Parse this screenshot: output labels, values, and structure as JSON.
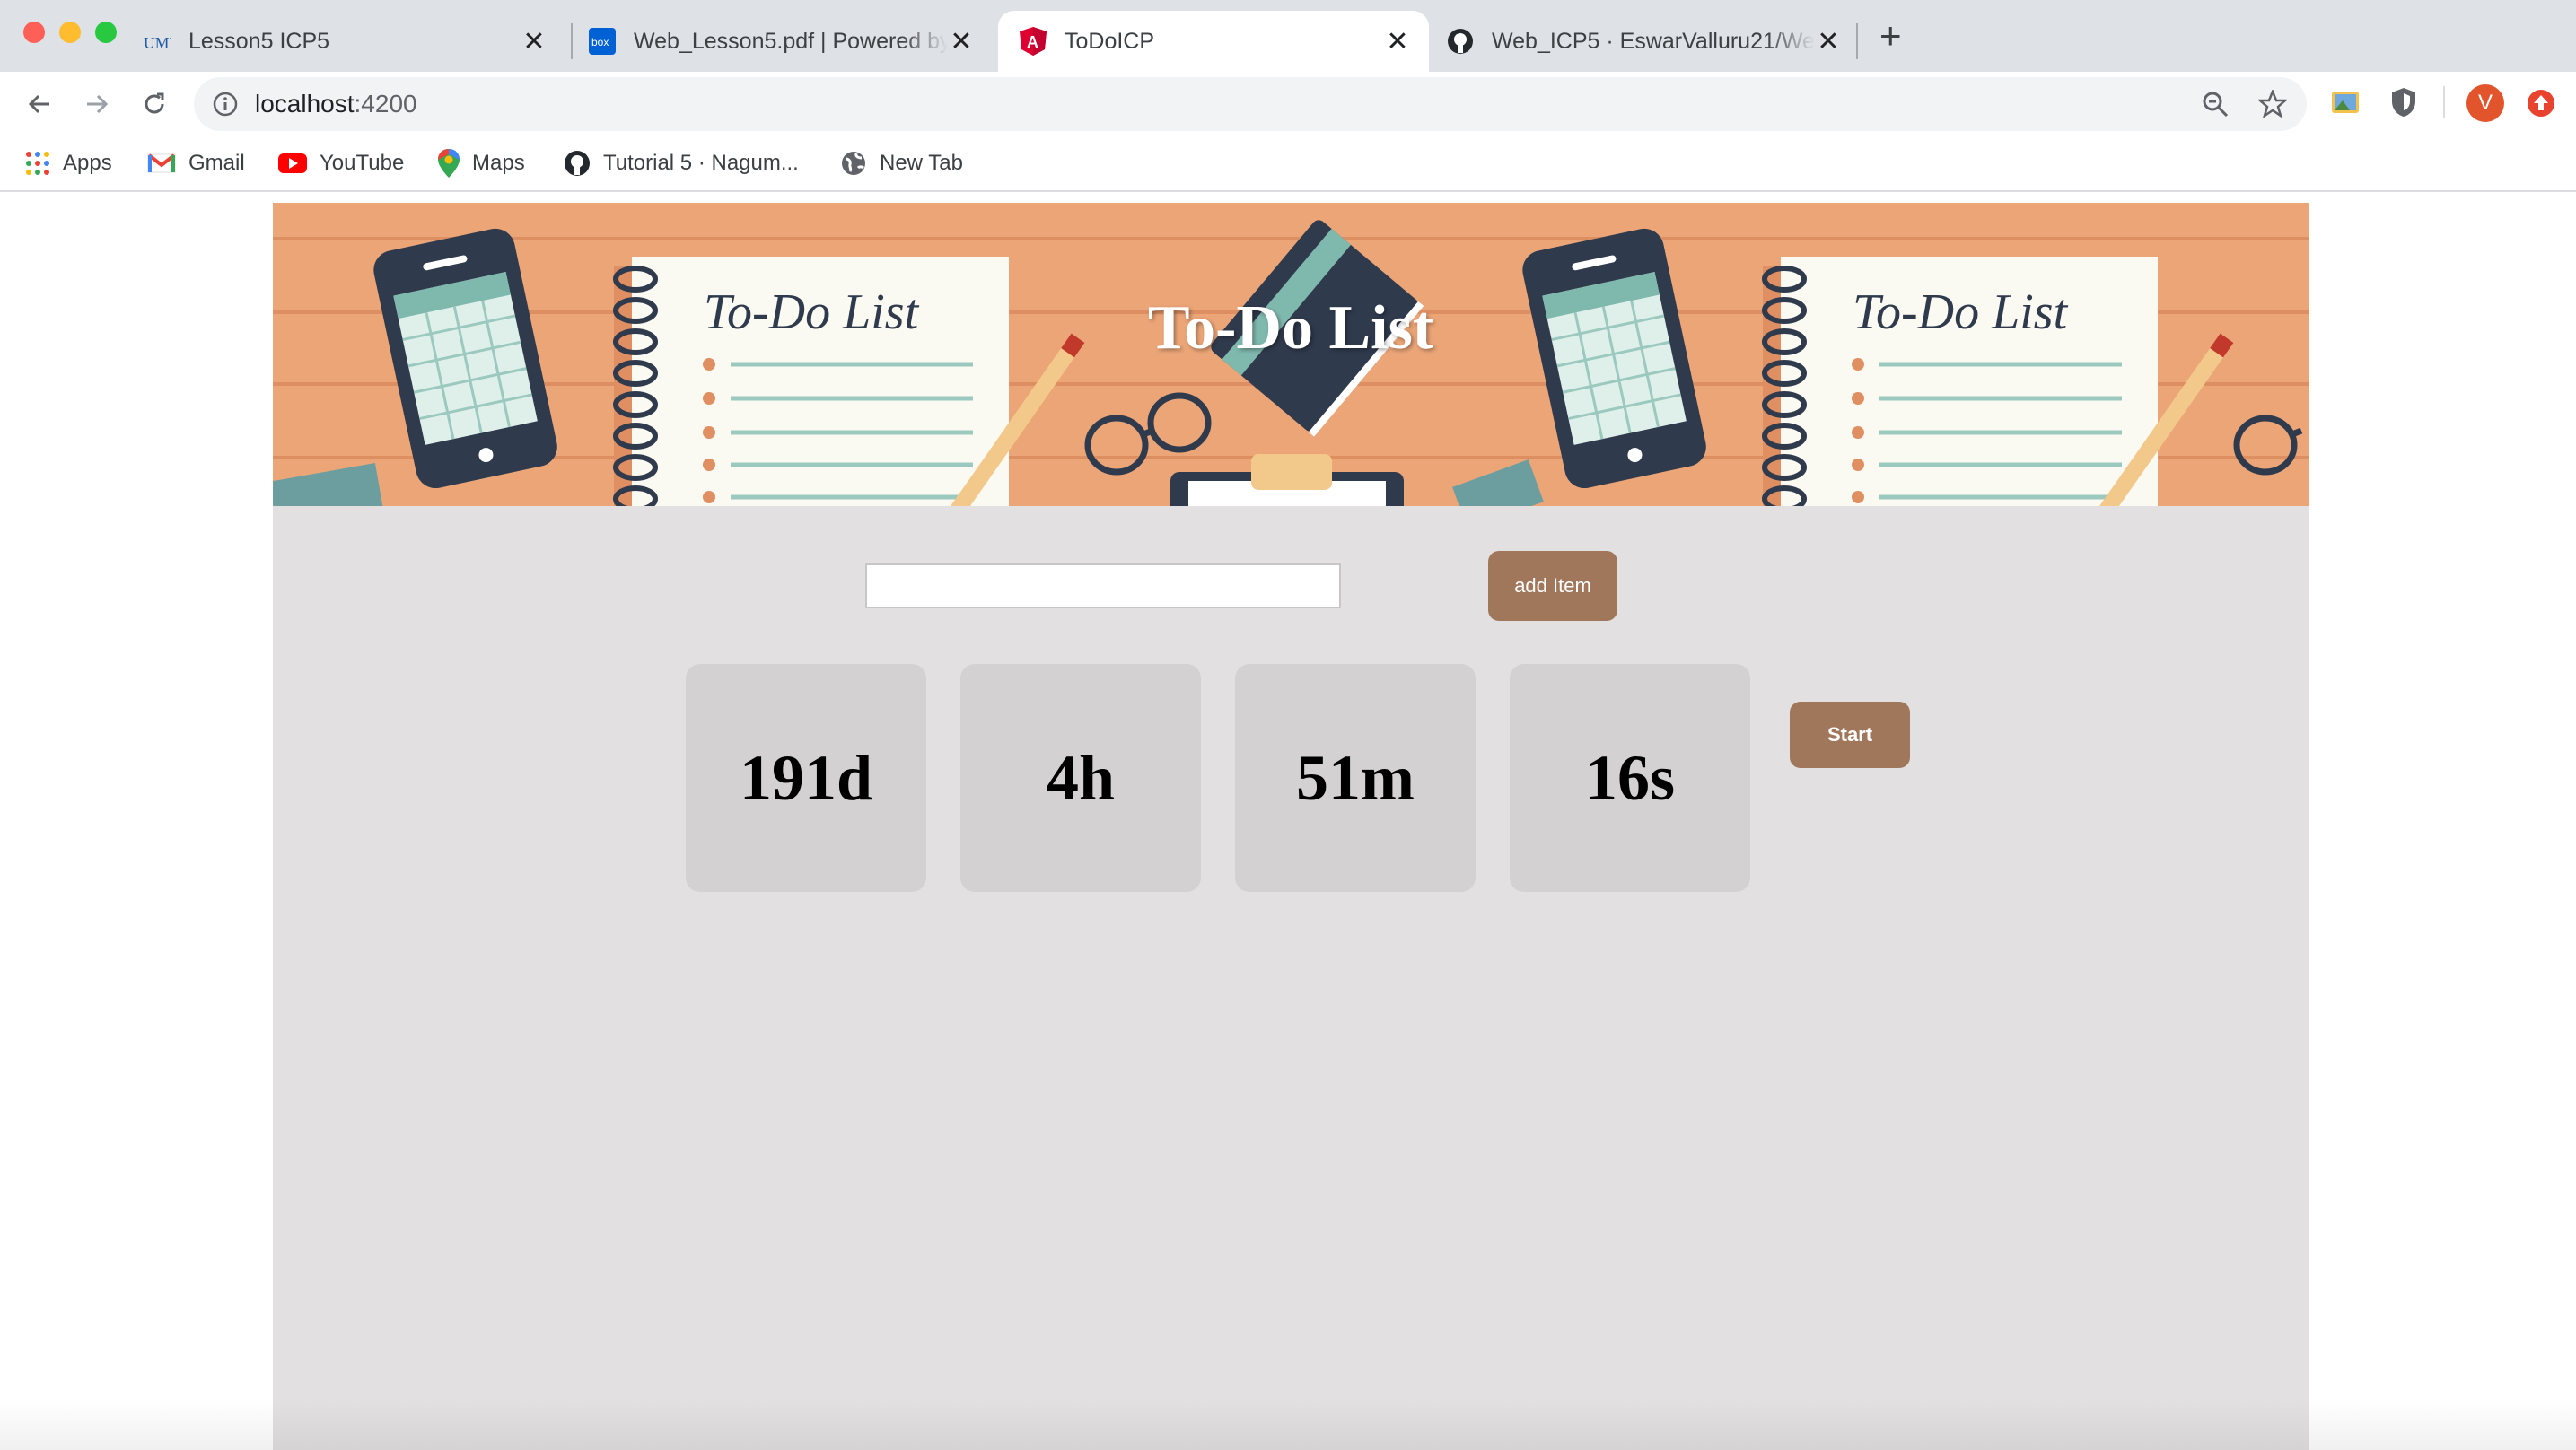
{
  "browser": {
    "tabs": [
      {
        "title": "Lesson5 ICP5",
        "favicon": "umkc-icon",
        "active": false
      },
      {
        "title": "Web_Lesson5.pdf | Powered by Box",
        "favicon": "box-icon",
        "active": false
      },
      {
        "title": "ToDoICP",
        "favicon": "angular-icon",
        "active": true
      },
      {
        "title": "Web_ICP5 · EswarValluru21/Web",
        "favicon": "github-icon",
        "active": false
      }
    ],
    "url_host": "localhost",
    "url_port": ":4200",
    "avatar_letter": "V",
    "bookmarks": [
      {
        "label": "Apps",
        "icon": "apps-grid-icon"
      },
      {
        "label": "Gmail",
        "icon": "gmail-icon"
      },
      {
        "label": "YouTube",
        "icon": "youtube-icon"
      },
      {
        "label": "Maps",
        "icon": "maps-pin-icon"
      },
      {
        "label": "Tutorial 5 · Nagum...",
        "icon": "github-icon"
      },
      {
        "label": "New Tab",
        "icon": "globe-icon"
      }
    ]
  },
  "app": {
    "banner_title": "To-Do List",
    "banner_art_text": "To-Do List",
    "todo_input": {
      "value": "",
      "placeholder": ""
    },
    "add_button_label": "add Item",
    "countdown": {
      "days": "191d",
      "hours": "4h",
      "minutes": "51m",
      "seconds": "16s"
    },
    "start_button_label": "Start",
    "colors": {
      "banner": "#eba577",
      "button": "#a0775a",
      "panel": "#e2e0e1",
      "box": "#d3d1d2"
    }
  }
}
